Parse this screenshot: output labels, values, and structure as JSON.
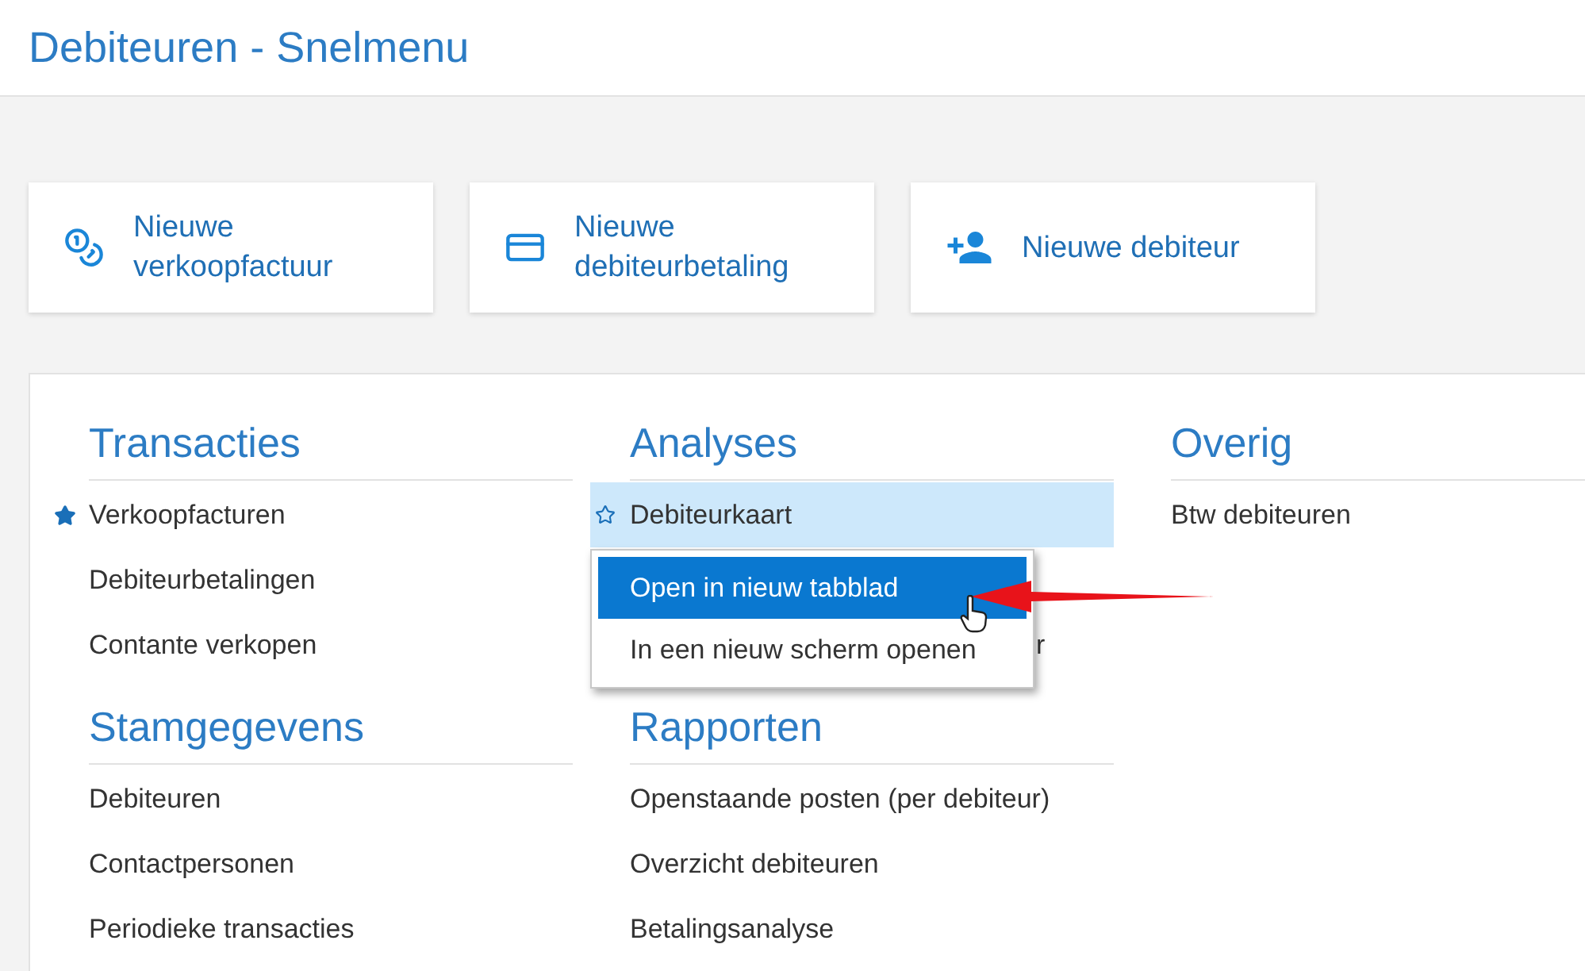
{
  "page": {
    "title": "Debiteuren - Snelmenu"
  },
  "quick_actions": [
    {
      "kind": "coins",
      "lines": [
        "Nieuwe",
        "verkoopfactuur"
      ]
    },
    {
      "kind": "card",
      "lines": [
        "Nieuwe",
        "debiteurbetaling"
      ]
    },
    {
      "kind": "person-add",
      "lines": [
        "Nieuwe debiteur"
      ]
    }
  ],
  "columns": [
    {
      "sections": [
        {
          "title": "Transacties",
          "items": [
            {
              "text": "Verkoopfacturen",
              "favorite": true,
              "hovered": false
            },
            {
              "text": "Debiteurbetalingen",
              "favorite": false,
              "hovered": false
            },
            {
              "text": "Contante verkopen",
              "favorite": false,
              "hovered": false
            }
          ]
        },
        {
          "title": "Stamgegevens",
          "items": [
            {
              "text": "Debiteuren",
              "favorite": false,
              "hovered": false
            },
            {
              "text": "Contactpersonen",
              "favorite": false,
              "hovered": false
            },
            {
              "text": "Periodieke transacties",
              "favorite": false,
              "hovered": false
            }
          ]
        }
      ]
    },
    {
      "sections": [
        {
          "title": "Analyses",
          "items": [
            {
              "text": "Debiteurkaart",
              "favorite": false,
              "hovered": true
            },
            {
              "text": "r",
              "kind": "covered"
            }
          ]
        },
        {
          "title": "Rapporten",
          "items": [
            {
              "text": "Openstaande posten (per debiteur)",
              "favorite": false,
              "hovered": false
            },
            {
              "text": "Overzicht debiteuren",
              "favorite": false,
              "hovered": false
            },
            {
              "text": "Betalingsanalyse",
              "favorite": false,
              "hovered": false
            }
          ]
        }
      ]
    },
    {
      "sections": [
        {
          "title": "Overig",
          "items": [
            {
              "text": "Btw debiteuren",
              "favorite": false,
              "hovered": false
            }
          ]
        }
      ]
    }
  ],
  "context_menu": {
    "items": [
      {
        "label": "Open in nieuw tabblad",
        "selected": true
      },
      {
        "label": "In een nieuw scherm openen",
        "selected": false
      }
    ]
  }
}
